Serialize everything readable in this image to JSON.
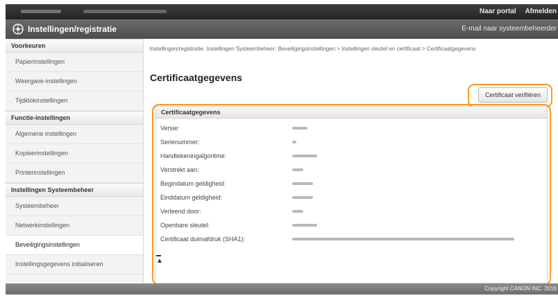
{
  "topbar": {
    "portal_link": "Naar portal",
    "logout_link": "Afmelden"
  },
  "header": {
    "title": "Instellingen/registratie",
    "email_link": "E-mail naar systeembeheerder"
  },
  "sidebar": {
    "sections": [
      {
        "label": "Voorkeuren",
        "items": [
          "Papierinstellingen",
          "Weergave-instellingen",
          "Tijdklokinstellingen"
        ]
      },
      {
        "label": "Functie-instellingen",
        "items": [
          "Algemene instellingen",
          "Kopieerinstellingen",
          "Printerinstellingen"
        ]
      },
      {
        "label": "Instellingen Systeembeheer",
        "items": [
          "Systeembeheer",
          "Netwerkinstellingen",
          "Beveiligingsinstellingen",
          "Instellingsgegevens initialiseren"
        ]
      }
    ],
    "active_item": "Beveiligingsinstellingen"
  },
  "main": {
    "breadcrumb": "Instellingen/registratie: Instellingen Systeembeheer: Beveiligingsinstellingen > Instellingen sleutel en certificaat > Certificaatgegevens",
    "title": "Certificaatgegevens",
    "verify_button": "Certificaat verifiëren",
    "cert_section_title": "Certificaatgegevens",
    "cert_rows": [
      "Versie:",
      "Serienummer:",
      "Handtekeningalgoritme:",
      "Verstrekt aan:",
      "Begindatum geldigheid:",
      "Einddatum geldigheid:",
      "Verleend door:",
      "Openbare sleutel:",
      "Certificaat duimafdruk (SHA1):"
    ]
  },
  "footer": {
    "copyright": "Copyright CANON INC. 2016"
  },
  "colors": {
    "highlight": "#f59b24",
    "header": "#5a5a5a",
    "topbar": "#2e2e2e"
  }
}
